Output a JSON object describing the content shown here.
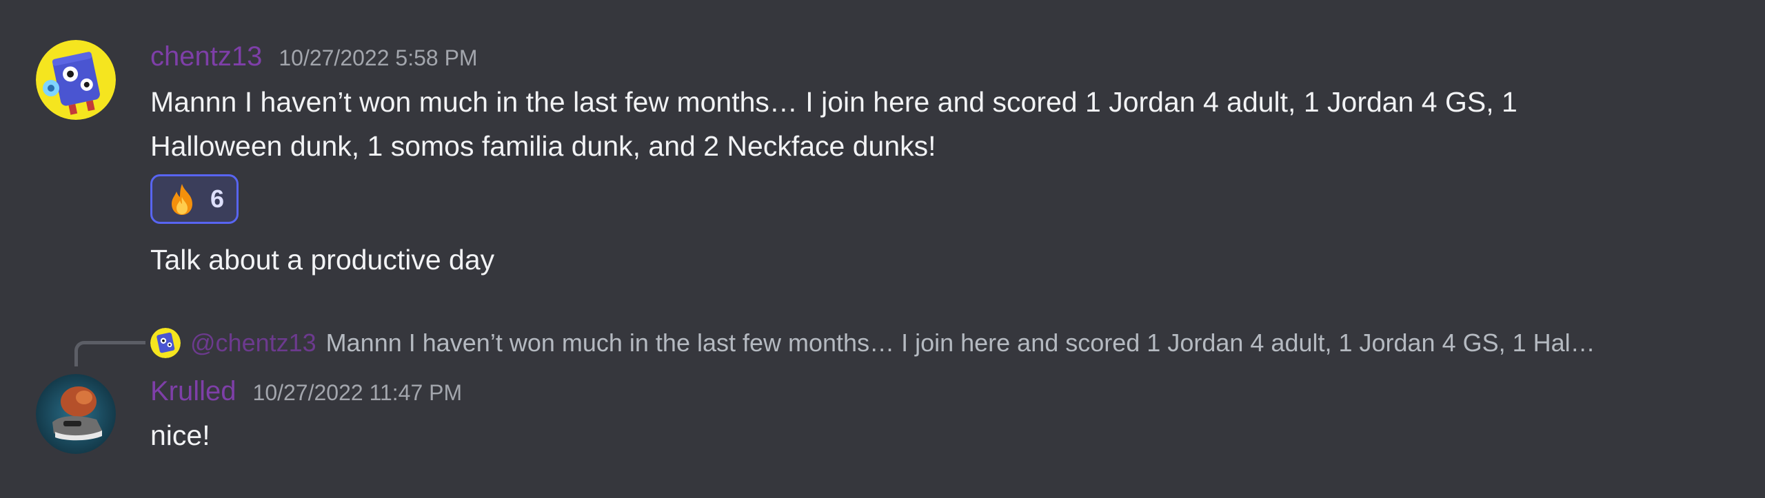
{
  "messages": [
    {
      "username": "chentz13",
      "timestamp": "10/27/2022 5:58 PM",
      "lines": [
        "Mannn I haven’t won much in the last few months… I join here and scored 1 Jordan 4 adult, 1 Jordan 4 GS, 1",
        "Halloween dunk, 1 somos familia dunk, and 2 Neckface dunks!"
      ],
      "reaction": {
        "emoji": "fire",
        "count": "6"
      },
      "followup": "Talk about a productive day"
    },
    {
      "reply": {
        "username": "@chentz13",
        "text": "Mannn I haven’t won much in the last few months… I join here and scored 1 Jordan 4 adult, 1 Jordan 4 GS, 1 Hal…"
      },
      "username": "Krulled",
      "timestamp": "10/27/2022 11:47 PM",
      "text": "nice!"
    }
  ],
  "colors": {
    "background": "#36373d",
    "username": "#7e3fa8",
    "reaction_border": "#5865f2",
    "text": "#f2f3f5",
    "muted": "#a3a6ad"
  }
}
